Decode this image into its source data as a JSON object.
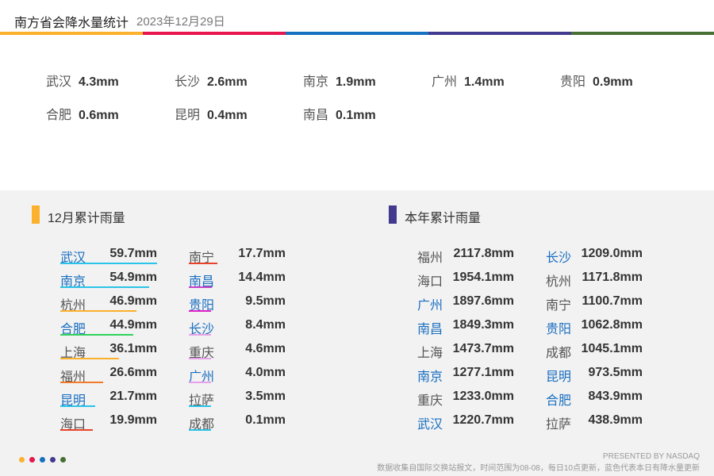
{
  "header": {
    "title": "南方省会降水量统计",
    "date": "2023年12月29日",
    "stripe_colors": [
      "#fbb12d",
      "#e8164f",
      "#1670c0",
      "#423a8f",
      "#466f33"
    ]
  },
  "daily": {
    "items": [
      {
        "city": "武汉",
        "value": "4.3mm"
      },
      {
        "city": "长沙",
        "value": "2.6mm"
      },
      {
        "city": "南京",
        "value": "1.9mm"
      },
      {
        "city": "广州",
        "value": "1.4mm"
      },
      {
        "city": "贵阳",
        "value": "0.9mm"
      },
      {
        "city": "合肥",
        "value": "0.6mm"
      },
      {
        "city": "昆明",
        "value": "0.4mm"
      },
      {
        "city": "南昌",
        "value": "0.1mm"
      }
    ]
  },
  "month": {
    "heading": "12月累计雨量",
    "accent": "#fbb12d"
  },
  "year": {
    "heading": "本年累计雨量",
    "accent": "#423a8f"
  },
  "chart_data": [
    {
      "type": "bar",
      "title": "12月累计雨量",
      "unit": "mm",
      "categories": [
        "武汉",
        "南京",
        "杭州",
        "合肥",
        "上海",
        "福州",
        "昆明",
        "海口",
        "南宁",
        "南昌",
        "贵阳",
        "长沙",
        "重庆",
        "广州",
        "拉萨",
        "成都"
      ],
      "values": [
        59.7,
        54.9,
        46.9,
        44.9,
        36.1,
        26.6,
        21.7,
        19.9,
        17.7,
        14.4,
        9.5,
        8.4,
        4.6,
        4.0,
        3.5,
        0.1
      ],
      "labels": [
        "59.7mm",
        "54.9mm",
        "46.9mm",
        "44.9mm",
        "36.1mm",
        "26.6mm",
        "21.7mm",
        "19.9mm",
        "17.7mm",
        "14.4mm",
        "9.5mm",
        "8.4mm",
        "4.6mm",
        "4.0mm",
        "3.5mm",
        "0.1mm"
      ],
      "highlight": [
        true,
        true,
        false,
        true,
        false,
        false,
        true,
        false,
        false,
        true,
        true,
        true,
        false,
        true,
        false,
        false
      ],
      "colors": [
        "#29c4e8",
        "#29c4e8",
        "#fbb12d",
        "#2fd35a",
        "#fbb12d",
        "#f07a2a",
        "#29c4e8",
        "#e8432a",
        "#e8432a",
        "#c940c9",
        "#e020c8",
        "#e8a0e8",
        "#e8a0e8",
        "#e8a0e8",
        "#29c4e8",
        "#29c4e8"
      ]
    },
    {
      "type": "table",
      "title": "本年累计雨量",
      "unit": "mm",
      "categories": [
        "福州",
        "海口",
        "广州",
        "南昌",
        "上海",
        "南京",
        "重庆",
        "武汉",
        "长沙",
        "杭州",
        "南宁",
        "贵阳",
        "成都",
        "昆明",
        "合肥",
        "拉萨"
      ],
      "values": [
        2117.8,
        1954.1,
        1897.6,
        1849.3,
        1473.7,
        1277.1,
        1233.0,
        1220.7,
        1209.0,
        1171.8,
        1100.7,
        1062.8,
        1045.1,
        973.5,
        843.9,
        438.9
      ],
      "labels": [
        "2117.8mm",
        "1954.1mm",
        "1897.6mm",
        "1849.3mm",
        "1473.7mm",
        "1277.1mm",
        "1233.0mm",
        "1220.7mm",
        "1209.0mm",
        "1171.8mm",
        "1100.7mm",
        "1062.8mm",
        "1045.1mm",
        "973.5mm",
        "843.9mm",
        "438.9mm"
      ],
      "highlight": [
        false,
        false,
        true,
        true,
        false,
        true,
        false,
        true,
        true,
        false,
        false,
        true,
        false,
        true,
        true,
        false
      ]
    }
  ],
  "footer": {
    "dot_colors": [
      "#fbb12d",
      "#e8164f",
      "#1670c0",
      "#423a8f",
      "#466f33"
    ],
    "credit": "PRESENTED BY NASDAQ",
    "note": "数据收集自国际交换站报文，时间范围为08-08，每日10点更新，蓝色代表本日有降水量更新"
  }
}
